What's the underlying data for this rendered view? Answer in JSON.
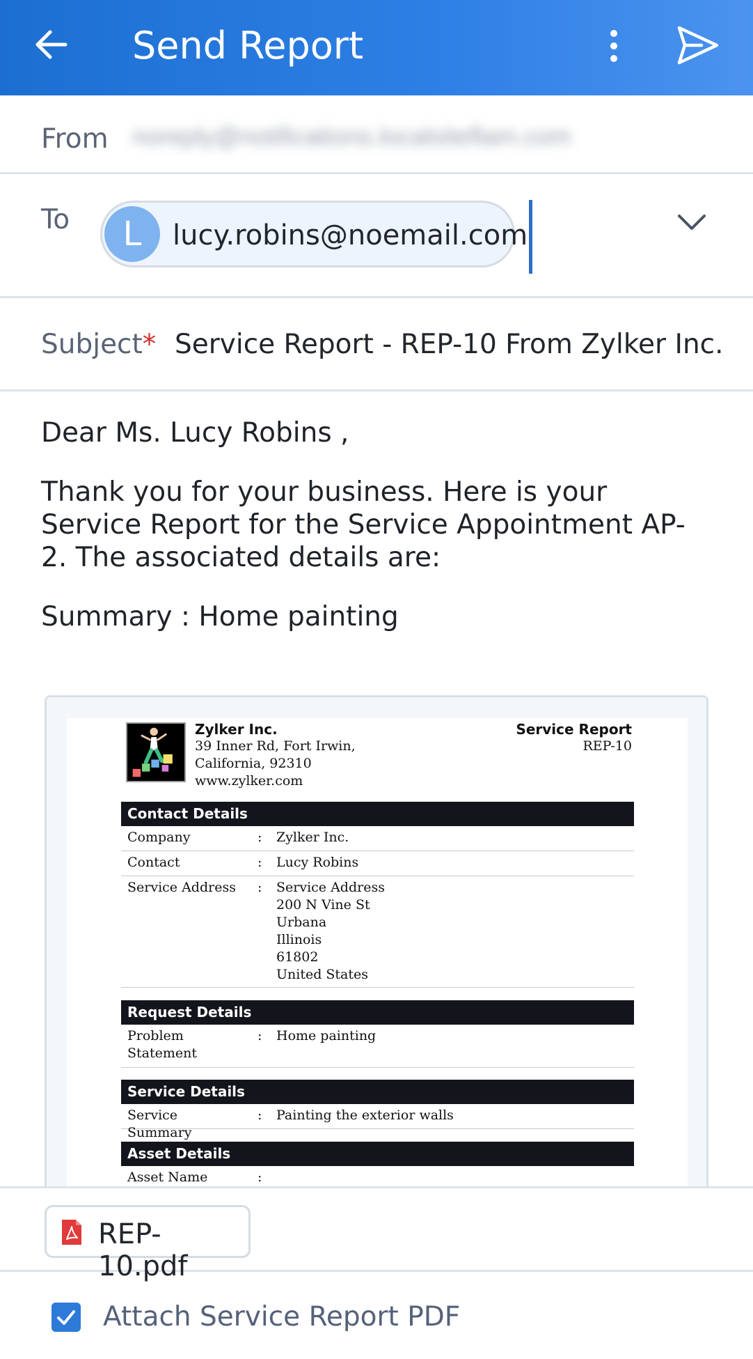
{
  "header": {
    "title": "Send Report"
  },
  "from": {
    "label": "From",
    "value": "noreply@notifications.localsiteflam.com"
  },
  "to": {
    "label": "To",
    "avatar_letter": "L",
    "recipient": "lucy.robins@noemail.com"
  },
  "subject": {
    "label": "Subject",
    "required_mark": "*",
    "value": "Service Report - REP-10 From Zylker Inc."
  },
  "body": {
    "greeting": "Dear Ms. Lucy Robins ,",
    "paragraph": "Thank you for your business. Here is your Service Report for the Service Appointment AP-2. The associated details are:",
    "summary": "Summary : Home painting"
  },
  "report": {
    "company_name": "Zylker Inc.",
    "address_line1": "39 Inner Rd, Fort Irwin,",
    "address_line2": "California, 92310",
    "website": "www.zylker.com",
    "doc_title": "Service Report",
    "doc_number": "REP-10",
    "sections": {
      "contact": "Contact Details",
      "request": "Request Details",
      "service": "Service Details",
      "asset": "Asset Details"
    },
    "colon": ":",
    "company_key": "Company",
    "company_val": "Zylker Inc.",
    "contact_key": "Contact",
    "contact_val": "Lucy Robins",
    "address_key": "Service Address",
    "address_val": [
      "Service Address",
      "200 N Vine St",
      "Urbana",
      "Illinois",
      "61802",
      "United States"
    ],
    "problem_key": [
      "Problem",
      "Statement"
    ],
    "problem_val": "Home painting",
    "summary_key": "Service Summary",
    "summary_val": "Painting the exterior walls",
    "asset_key": "Asset Name"
  },
  "attachment": {
    "file_name": "REP-10.pdf"
  },
  "attach_option": {
    "label": "Attach Service Report PDF",
    "checked": true
  },
  "colors": {
    "accent": "#2f80e6",
    "required": "#d0302b",
    "checkbox": "#2d7ad8"
  }
}
